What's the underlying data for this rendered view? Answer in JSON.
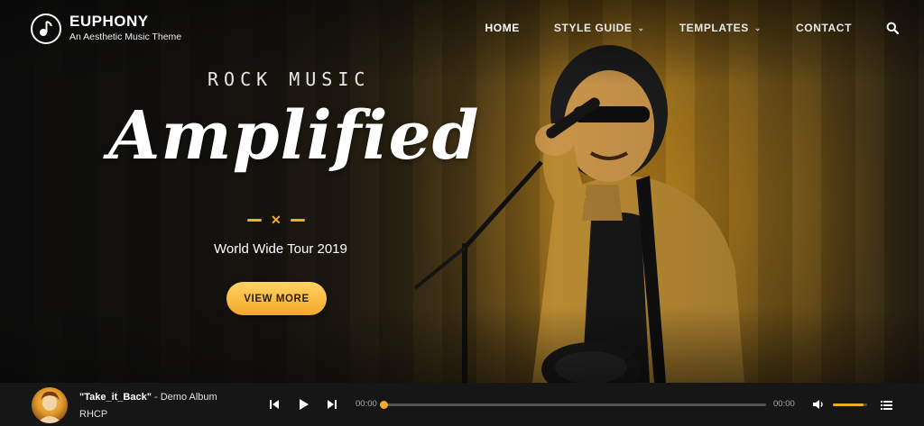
{
  "brand": {
    "name": "EUPHONY",
    "tagline": "An Aesthetic Music Theme"
  },
  "nav": {
    "items": [
      {
        "label": "HOME",
        "active": true,
        "has_dropdown": false
      },
      {
        "label": "STYLE GUIDE",
        "active": false,
        "has_dropdown": true
      },
      {
        "label": "TEMPLATES",
        "active": false,
        "has_dropdown": true
      },
      {
        "label": "CONTACT",
        "active": false,
        "has_dropdown": false
      }
    ],
    "search_icon": "search-icon"
  },
  "hero": {
    "eyebrow": "ROCK MUSIC",
    "headline": "Amplified",
    "subtitle": "World Wide Tour 2019",
    "cta_label": "VIEW MORE"
  },
  "player": {
    "track_title": "\"Take_it_Back\"",
    "album": " - Demo Album",
    "artist": "RHCP",
    "time_current": "00:00",
    "time_total": "00:00",
    "progress": 0,
    "volume": 0.9
  },
  "colors": {
    "accent": "#f2ac2b",
    "player_bg": "#161616"
  }
}
